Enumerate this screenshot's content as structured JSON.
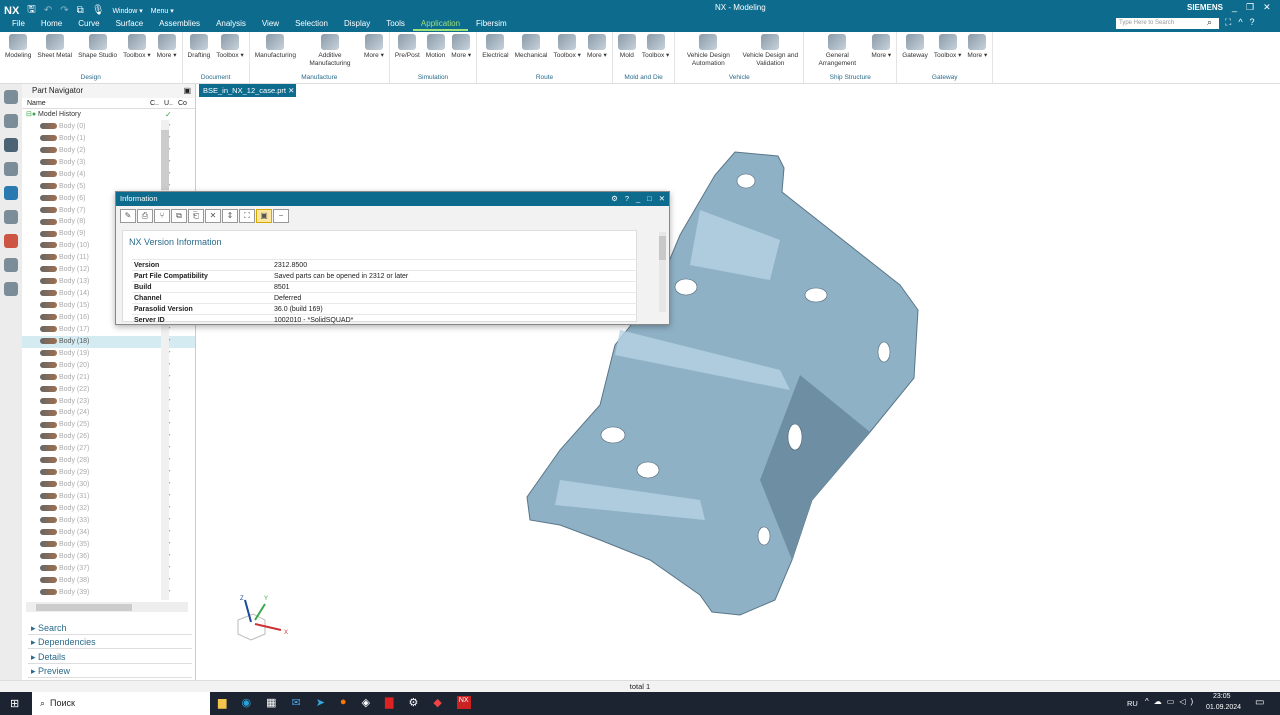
{
  "app": {
    "logo": "NX",
    "title": "NX - Modeling",
    "brand": "SIEMENS",
    "window_menu": "Window ▾",
    "menu_menu": "Menu ▾",
    "search_placeholder": "Type Here to Search"
  },
  "tabs": [
    "File",
    "Home",
    "Curve",
    "Surface",
    "Assemblies",
    "Analysis",
    "View",
    "Selection",
    "Display",
    "Tools",
    "Application",
    "Fibersim"
  ],
  "active_tab": "Application",
  "ribbon": [
    {
      "group": "Design",
      "items": [
        "Modeling",
        "Sheet Metal",
        "Shape Studio",
        "Toolbox ▾",
        "More ▾"
      ]
    },
    {
      "group": "Document",
      "items": [
        "Drafting",
        "Toolbox ▾"
      ]
    },
    {
      "group": "Manufacture",
      "items": [
        "Manufacturing",
        "Additive Manufacturing",
        "More ▾"
      ]
    },
    {
      "group": "Simulation",
      "items": [
        "Pre/Post",
        "Motion",
        "More ▾"
      ]
    },
    {
      "group": "Route",
      "items": [
        "Electrical",
        "Mechanical",
        "Toolbox ▾",
        "More ▾"
      ]
    },
    {
      "group": "Mold and Die",
      "items": [
        "Mold",
        "Toolbox ▾"
      ]
    },
    {
      "group": "Vehicle",
      "items": [
        "Vehicle Design Automation",
        "Vehicle Design and Validation"
      ]
    },
    {
      "group": "Ship Structure",
      "items": [
        "General Arrangement",
        "More ▾"
      ]
    },
    {
      "group": "Gateway",
      "items": [
        "Gateway",
        "Toolbox ▾",
        "More ▾"
      ]
    }
  ],
  "navigator": {
    "title": "Part Navigator",
    "columns": [
      "Name",
      "C..",
      "U..",
      "Co"
    ],
    "root": "Model History",
    "selected": "Body (18)",
    "bodies": [
      "Body (0)",
      "Body (1)",
      "Body (2)",
      "Body (3)",
      "Body (4)",
      "Body (5)",
      "Body (6)",
      "Body (7)",
      "Body (8)",
      "Body (9)",
      "Body (10)",
      "Body (11)",
      "Body (12)",
      "Body (13)",
      "Body (14)",
      "Body (15)",
      "Body (16)",
      "Body (17)",
      "Body (18)",
      "Body (19)",
      "Body (20)",
      "Body (21)",
      "Body (22)",
      "Body (23)",
      "Body (24)",
      "Body (25)",
      "Body (26)",
      "Body (27)",
      "Body (28)",
      "Body (29)",
      "Body (30)",
      "Body (31)",
      "Body (32)",
      "Body (33)",
      "Body (34)",
      "Body (35)",
      "Body (36)",
      "Body (37)",
      "Body (38)",
      "Body (39)"
    ],
    "sections": [
      "Search",
      "Dependencies",
      "Details",
      "Preview"
    ]
  },
  "document_tab": "BSE_in_NX_12_case.prt",
  "info_dialog": {
    "title": "Information",
    "heading": "NX Version Information",
    "rows": [
      [
        "Version",
        "2312.8500"
      ],
      [
        "Part File Compatibility",
        "Saved parts can be opened in 2312 or later"
      ],
      [
        "Build",
        "8501"
      ],
      [
        "Channel",
        "Deferred"
      ],
      [
        "Parasolid Version",
        "36.0 (build 169)"
      ],
      [
        "Server ID",
        "1002010 - *SolidSQUAD*"
      ]
    ]
  },
  "triad": {
    "x": "X",
    "y": "Y",
    "z": "Z"
  },
  "status": "total 1",
  "taskbar": {
    "search": "Поиск",
    "lang": "RU",
    "time": "23:05",
    "date": "01.09.2024"
  },
  "colors": {
    "brand": "#0d6b8e",
    "part": "#8fb1c6"
  }
}
